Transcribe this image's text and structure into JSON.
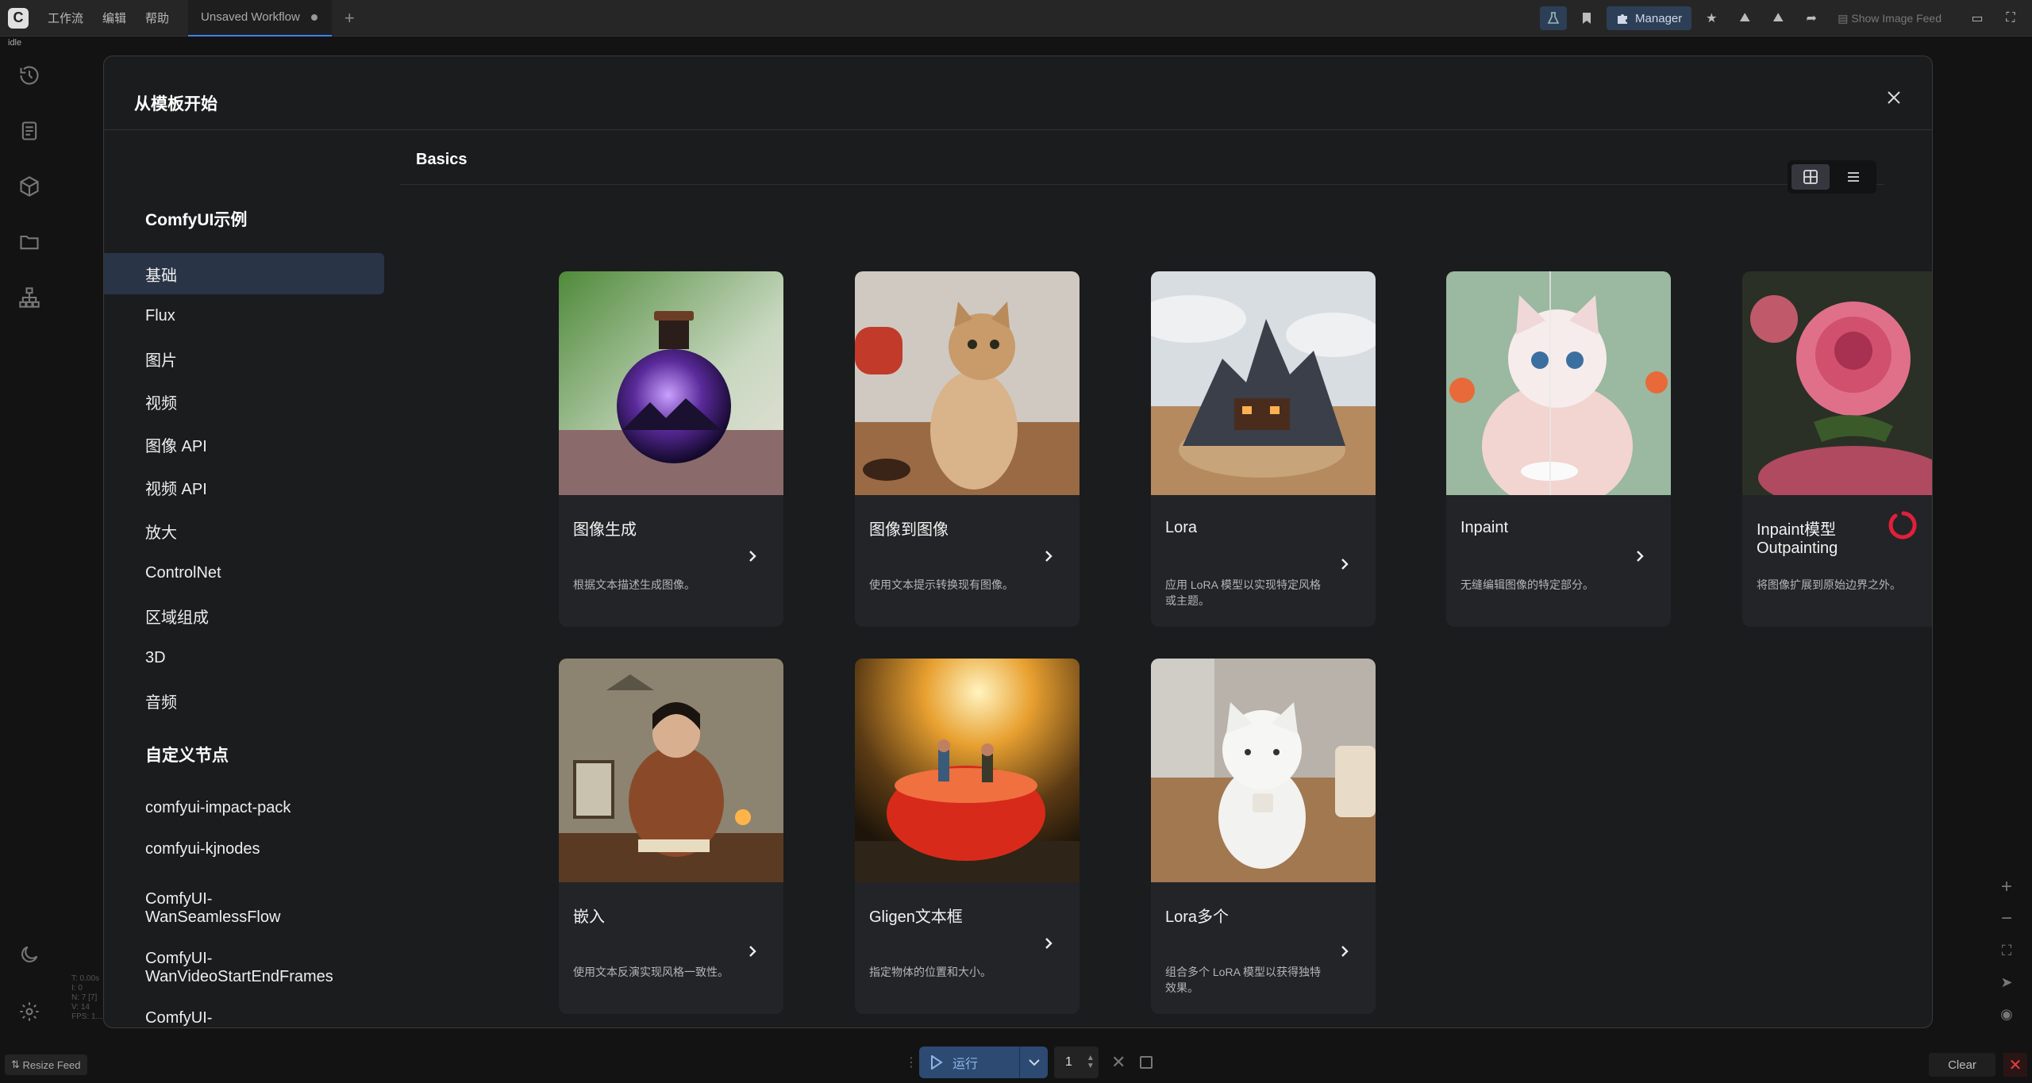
{
  "menubar": {
    "items": [
      "工作流",
      "编辑",
      "帮助"
    ],
    "tab_title": "Unsaved Workflow",
    "manager_label": "Manager",
    "show_feed_label": "Show Image Feed"
  },
  "status": {
    "state": "idle"
  },
  "stats": [
    "T: 0.00s",
    "I: 0",
    "N: 7 [7]",
    "V: 14",
    "FPS: 1..."
  ],
  "modal": {
    "title": "从模板开始",
    "nav": {
      "section1": "ComfyUI示例",
      "items1": [
        "基础",
        "Flux",
        "图片",
        "视频",
        "图像 API",
        "视频 API",
        "放大",
        "ControlNet",
        "区域组成",
        "3D",
        "音频"
      ],
      "section2": "自定义节点",
      "items2": [
        "comfyui-impact-pack",
        "comfyui-kjnodes",
        "ComfyUI-WanSeamlessFlow",
        "ComfyUI-WanVideoStartEndFrames",
        "ComfyUI-WanVideoWrapper"
      ]
    },
    "content_title": "Basics",
    "cards": [
      {
        "title": "图像生成",
        "desc": "根据文本描述生成图像。"
      },
      {
        "title": "图像到图像",
        "desc": "使用文本提示转换现有图像。"
      },
      {
        "title": "Lora",
        "desc": "应用 LoRA 模型以实现特定风格或主题。"
      },
      {
        "title": "Inpaint",
        "desc": "无缝编辑图像的特定部分。"
      },
      {
        "title": "Inpaint模型 Outpainting",
        "desc": "将图像扩展到原始边界之外。"
      },
      {
        "title": "嵌入",
        "desc": "使用文本反演实现风格一致性。"
      },
      {
        "title": "Gligen文本框",
        "desc": "指定物体的位置和大小。"
      },
      {
        "title": "Lora多个",
        "desc": "组合多个 LoRA 模型以获得独特效果。"
      }
    ]
  },
  "bottombar": {
    "resize_feed": "Resize Feed",
    "run_label": "运行",
    "batch_count": "1",
    "clear_label": "Clear"
  },
  "colors": {
    "accent": "#3b82f6",
    "run_bg": "#2c4a72",
    "active_nav": "#293447",
    "alert": "#e53e3e"
  }
}
